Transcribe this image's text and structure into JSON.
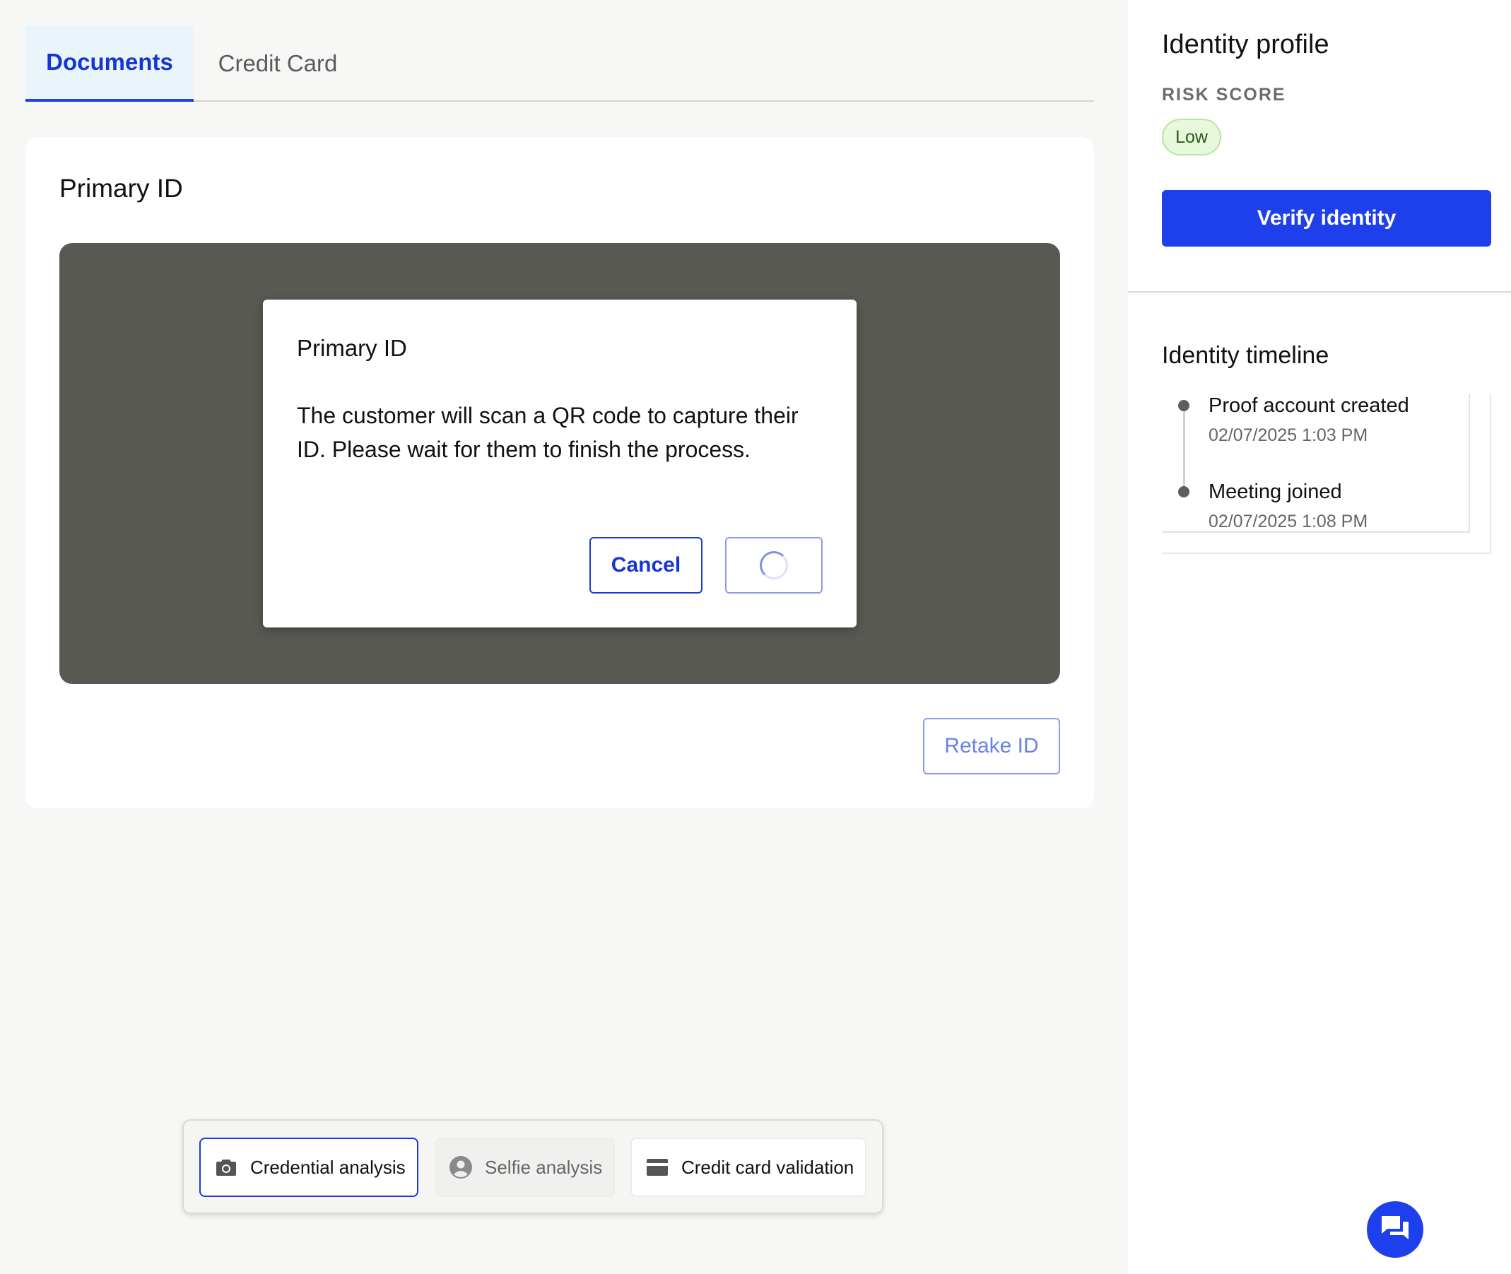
{
  "tabs": [
    {
      "label": "Documents",
      "active": true
    },
    {
      "label": "Credit Card",
      "active": false
    }
  ],
  "card": {
    "title": "Primary ID",
    "retake_label": "Retake ID"
  },
  "dialog": {
    "title": "Primary ID",
    "body": "The customer will scan a QR code to capture their ID. Please wait for them to finish the process.",
    "cancel_label": "Cancel",
    "loading_icon": "spinner-icon"
  },
  "toolbar": {
    "items": [
      {
        "label": "Credential analysis",
        "icon": "camera-icon",
        "selected": true
      },
      {
        "label": "Selfie analysis",
        "icon": "person-icon",
        "disabled": true
      },
      {
        "label": "Credit card validation",
        "icon": "credit-card-icon"
      }
    ]
  },
  "sidebar": {
    "title": "Identity profile",
    "risk_label": "RISK SCORE",
    "risk_value": "Low",
    "verify_label": "Verify identity",
    "timeline_title": "Identity timeline",
    "timeline": [
      {
        "event": "Proof account created",
        "time": "02/07/2025 1:03 PM"
      },
      {
        "event": "Meeting joined",
        "time": "02/07/2025 1:08 PM"
      }
    ]
  },
  "chat": {
    "icon": "chat-icon"
  },
  "colors": {
    "accent": "#1e40ec",
    "tab_active_bg": "#e9f4fb",
    "preview_bg": "#595953",
    "risk_low_bg": "#e8f8dc"
  }
}
